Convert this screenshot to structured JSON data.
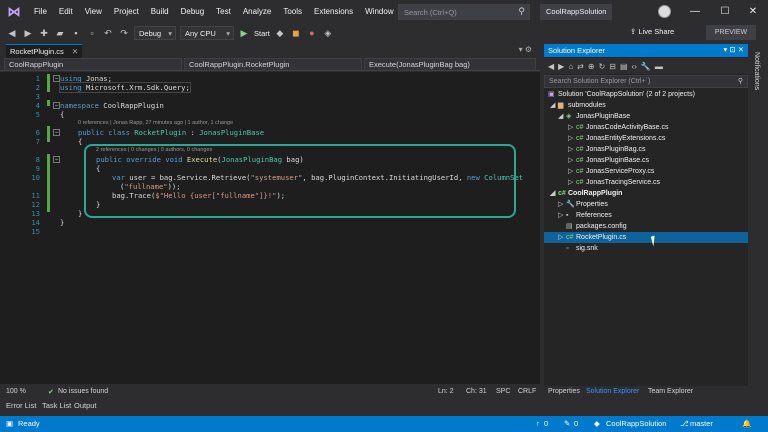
{
  "menu": [
    "File",
    "Edit",
    "View",
    "Project",
    "Build",
    "Debug",
    "Test",
    "Analyze",
    "Tools",
    "Extensions",
    "Window",
    "Help"
  ],
  "search_placeholder": "Search (Ctrl+Q)",
  "solution_name": "CoolRappSolution",
  "toolbar": {
    "config": "Debug",
    "platform": "Any CPU",
    "start": "Start",
    "live_share": "Live Share",
    "preview": "PREVIEW"
  },
  "editor": {
    "tab_label": "RocketPlugin.cs",
    "nav_project": "CoolRappPlugin",
    "nav_class": "CoolRappPlugin.RocketPlugin",
    "nav_member": "Execute(JonasPluginBag bag)",
    "lines": [
      "1",
      "2",
      "3",
      "4",
      "5",
      "6",
      "7",
      "8",
      "9",
      "10",
      "11",
      "12",
      "13",
      "14",
      "15"
    ],
    "code": {
      "l1_kw": "using",
      "l1_rest": " Jonas;",
      "l2_kw": "using",
      "l2_rest": " Microsoft.Xrm.Sdk.Query;",
      "l4_kw": "namespace",
      "l4_rest": " CoolRappPlugin",
      "l5": "{",
      "lens_class": "0 references | Jonas Rapp, 27 minutes ago | 1 author, 1 change",
      "l6_kw": "public class",
      "l6_name": " RocketPlugin",
      "l6_sep": " : ",
      "l6_base": "JonasPluginBase",
      "l7": "{",
      "lens_method": "2 references | 0 changes | 0 authors, 0 changes",
      "l8_kw": "public override void",
      "l8_fn": " Execute",
      "l8_open": "(",
      "l8_type": "JonasPluginBag",
      "l8_rest": " bag)",
      "l9": "{",
      "l10_kw": "var",
      "l10_a": " user = bag.Service.Retrieve(",
      "l10_str": "\"systemuser\"",
      "l10_b": ", bag.PluginContext.InitiatingUserId, ",
      "l10_kw2": "new",
      "l10_type": " ColumnSet",
      "l10c_str": "\"fullname\"",
      "l10c_rest": "));",
      "l11_a": "bag.Trace(",
      "l11_str": "$\"Hello {user[\"fullname\"]}!\"",
      "l11_rest": ");",
      "l12": "}",
      "l13": "}",
      "l14": "}"
    },
    "status": {
      "zoom": "100 %",
      "issues": "No issues found",
      "ln": "Ln: 2",
      "ch": "Ch: 31",
      "spc": "SPC",
      "crlf": "CRLF"
    }
  },
  "bottom_tabs": [
    "Error List",
    "Task List",
    "Output"
  ],
  "solution_explorer": {
    "title": "Solution Explorer",
    "search_placeholder": "Search Solution Explorer (Ctrl+´)",
    "items": [
      {
        "label": "Solution 'CoolRappSolution' (2 of 2 projects)",
        "icon": "solution-icon"
      },
      {
        "label": "submodules",
        "icon": "folder-icon"
      },
      {
        "label": "JonasPluginBase",
        "icon": "shared-project-icon"
      },
      {
        "label": "JonasCodeActivityBase.cs",
        "icon": "cs-file-icon"
      },
      {
        "label": "JonasEntityExtensions.cs",
        "icon": "cs-file-icon"
      },
      {
        "label": "JonasPluginBag.cs",
        "icon": "cs-file-icon"
      },
      {
        "label": "JonasPluginBase.cs",
        "icon": "cs-file-icon"
      },
      {
        "label": "JonasServiceProxy.cs",
        "icon": "cs-file-icon"
      },
      {
        "label": "JonasTracingService.cs",
        "icon": "cs-file-icon"
      },
      {
        "label": "CoolRappPlugin",
        "icon": "cs-project-icon"
      },
      {
        "label": "Properties",
        "icon": "properties-icon"
      },
      {
        "label": "References",
        "icon": "references-icon"
      },
      {
        "label": "packages.config",
        "icon": "config-file-icon"
      },
      {
        "label": "RocketPlugin.cs",
        "icon": "cs-file-icon"
      },
      {
        "label": "sig.snk",
        "icon": "key-file-icon"
      }
    ],
    "tabs": [
      "Properties",
      "Solution Explorer",
      "Team Explorer"
    ]
  },
  "notifications_label": "Notifications",
  "statusbar": {
    "ready": "Ready",
    "up": "0",
    "pencil": "0",
    "solution": "CoolRappSolution",
    "branch": "master"
  },
  "colors": {
    "accent": "#007acc",
    "highlight_box": "#2ea694",
    "keyword": "#569cd6",
    "type": "#4ec9b0",
    "string": "#d69d85"
  }
}
